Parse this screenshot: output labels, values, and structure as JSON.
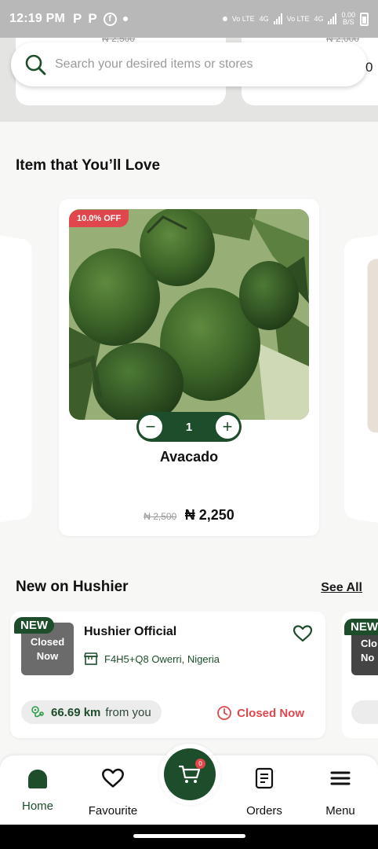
{
  "status_bar": {
    "time": "12:19 PM",
    "icons": [
      "p-icon",
      "p-icon",
      "facebook-icon",
      "dot-icon",
      "dot-icon",
      "volte-icon",
      "signal-icon",
      "volte-icon",
      "signal-icon",
      "data-speed-icon",
      "battery-icon"
    ],
    "p1": "P",
    "p2": "P",
    "fb": "f",
    "volte": "Vo LTE",
    "net": "4G",
    "speed_top": "0.00",
    "speed_bottom": "B/S"
  },
  "top_strip": {
    "peek_price_left": "₦ 2,500",
    "peek_price_right": "₦ 2,000",
    "peek_trailing_char": "0"
  },
  "search": {
    "placeholder": "Search your desired items or stores",
    "value": ""
  },
  "section_love": {
    "title": "Item that You’ll Love"
  },
  "product": {
    "discount": "10.0% OFF",
    "image": "avocado-photo",
    "quantity": "1",
    "minus": "−",
    "plus": "+",
    "name": "Avacado",
    "old_price": "₦ 2,500",
    "new_price": "₦ 2,250"
  },
  "section_new": {
    "title": "New on Hushier",
    "see_all": "See All"
  },
  "store": {
    "badge": "NEW",
    "logo_line1": "Closed",
    "logo_line2": "Now",
    "name": "Hushier Official",
    "address": "F4H5+Q8 Owerri, Nigeria",
    "distance": "66.69 km",
    "distance_suffix": "from you",
    "status": "Closed Now"
  },
  "store_peek": {
    "badge": "NEW",
    "logo_line1": "Clo",
    "logo_line2": "No"
  },
  "bottom_nav": {
    "home": "Home",
    "favourite": "Favourite",
    "orders": "Orders",
    "menu": "Menu",
    "cart_count": "0"
  },
  "colors": {
    "brand_green": "#1d4d2b",
    "accent_red": "#e0474c"
  }
}
